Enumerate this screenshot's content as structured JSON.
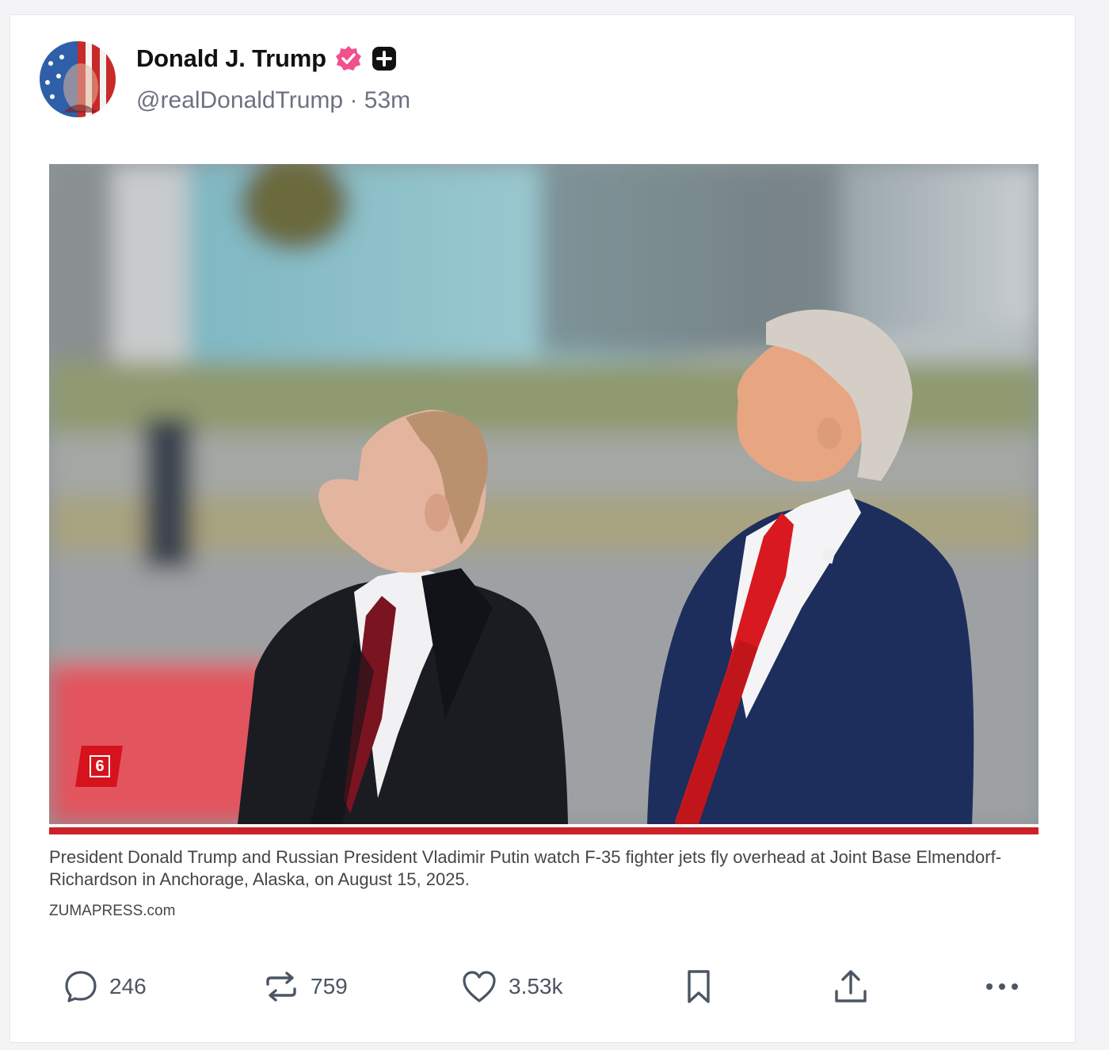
{
  "post": {
    "display_name": "Donald J. Trump",
    "handle": "@realDonaldTrump",
    "separator": "·",
    "time": "53m",
    "verified_badge_icon": "verified-check-icon",
    "plus_icon": "plus-square-icon",
    "avatar_icon": "american-flag-portrait-avatar"
  },
  "media": {
    "photo_description_icon": "photo",
    "watermark_number": "6",
    "caption": "President Donald Trump and Russian President Vladimir Putin watch F-35 fighter jets fly overhead at Joint Base Elmendorf-Richardson in Anchorage, Alaska, on August 15, 2025.",
    "credit": "ZUMAPRESS.com",
    "accent_color": "#cc2128"
  },
  "actions": {
    "reply_count": "246",
    "repost_count": "759",
    "like_count": "3.53k",
    "reply_icon": "speech-bubble-icon",
    "repost_icon": "repost-arrows-icon",
    "like_icon": "heart-icon",
    "bookmark_icon": "bookmark-icon",
    "share_icon": "share-upload-icon",
    "more_icon": "ellipsis-icon"
  }
}
